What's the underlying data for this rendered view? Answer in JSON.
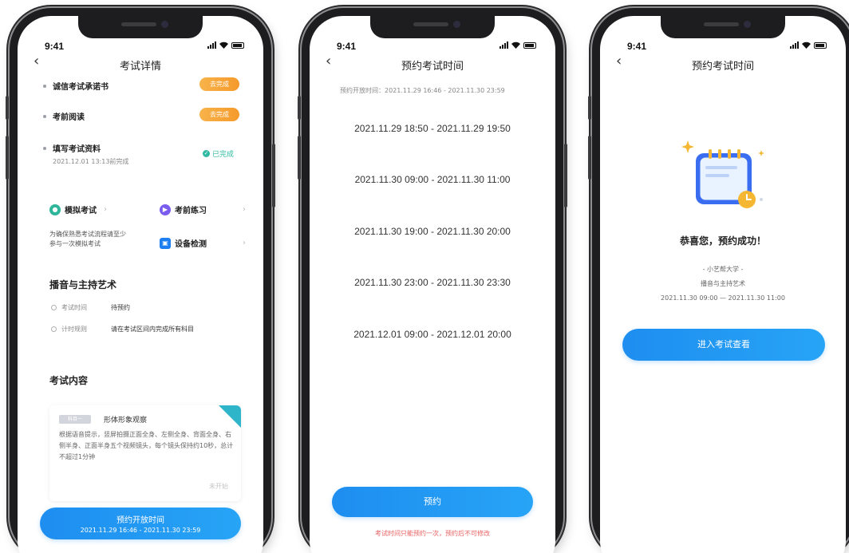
{
  "status_time": "9:41",
  "screens": [
    {
      "title": "考试详情",
      "tasks": [
        {
          "title": "诚信考试承诺书",
          "status": "去完成"
        },
        {
          "title": "考前阅读",
          "status": "去完成"
        },
        {
          "title": "填写考试资料",
          "sub": "2021.12.01 13:13前完成",
          "status": "已完成"
        }
      ],
      "entries": [
        {
          "label": "模拟考试",
          "icon": "mock-exam-icon",
          "color": "#2fb59a"
        },
        {
          "label": "考前练习",
          "icon": "practice-icon",
          "color": "#7a5cf0"
        },
        {
          "label": "设备检测",
          "icon": "device-check-icon",
          "color": "#1e7ff0"
        }
      ],
      "entry_desc": "为确保熟悉考试流程请至少参与一次模拟考试",
      "subject_title": "播音与主持艺术",
      "info": [
        {
          "key": "考试时间",
          "value": "待预约"
        },
        {
          "key": "计时规则",
          "value": "请在考试区间内完成所有科目"
        }
      ],
      "content_title": "考试内容",
      "subject": {
        "tag": "科目一",
        "name": "形体形象观察",
        "desc": "根据语音提示，竖屏拍摄正面全身、左侧全身、背面全身、右侧半身、正面半身五个视频镜头，每个镜头保持约10秒，总计不超过1分钟",
        "status": "未开始"
      },
      "cta": {
        "line1": "预约开放时间",
        "line2": "2021.11.29 16:46 - 2021.11.30 23:59"
      }
    },
    {
      "title": "预约考试时间",
      "open_time": "预约开放时间：2021.11.29 16:46 - 2021.11.30 23:59",
      "slots": [
        "2021.11.29 18:50 - 2021.11.29 19:50",
        "2021.11.30 09:00 - 2021.11.30 11:00",
        "2021.11.30 19:00 - 2021.11.30 20:00",
        "2021.11.30 23:00 - 2021.11.30 23:30",
        "2021.12.01 09:00 - 2021.12.01 20:00"
      ],
      "cta": "预约",
      "warning": "考试时间只能预约一次，预约后不可修改"
    },
    {
      "title": "预约考试时间",
      "success": "恭喜您，预约成功！",
      "school": "- 小艺帮大学 -",
      "major": "播音与主持艺术",
      "time": "2021.11.30 09:00 — 2021.11.30 11:00",
      "cta": "进入考试查看"
    }
  ],
  "colors": {
    "primary": "#1e8ef0",
    "orange": "#f59a2c",
    "success": "#2fb9a0",
    "warning": "#e86262"
  }
}
